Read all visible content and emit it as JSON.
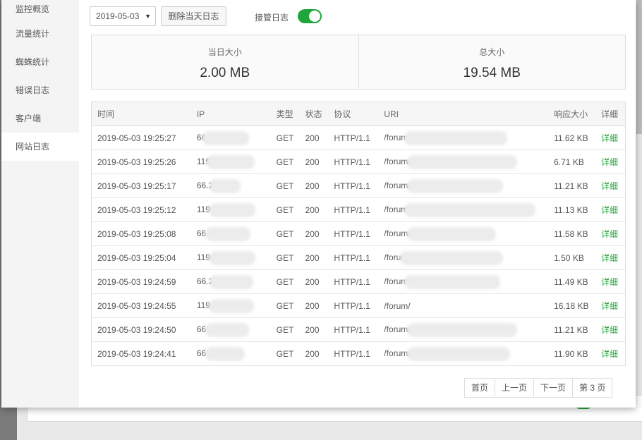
{
  "sidebar": {
    "items": [
      {
        "label": "监控概览"
      },
      {
        "label": "流量统计"
      },
      {
        "label": "蜘蛛统计"
      },
      {
        "label": "错误日志"
      },
      {
        "label": "客户端"
      },
      {
        "label": "网站日志"
      }
    ],
    "active_index": 5
  },
  "toolbar": {
    "date_value": "2019-05-03",
    "clear_label": "删除当天日志",
    "takeover_label": "接管日志",
    "takeover_on": true
  },
  "stats": {
    "day_label": "当日大小",
    "day_value": "2.00 MB",
    "total_label": "总大小",
    "total_value": "19.54 MB"
  },
  "table": {
    "headers": [
      "时间",
      "IP",
      "类型",
      "状态",
      "协议",
      "URI",
      "响应大小",
      "详细"
    ],
    "rows": [
      {
        "time": "2019-05-03 19:25:27",
        "ip": "66",
        "type": "GET",
        "status": "200",
        "proto": "HTTP/1.1",
        "uri": "/forum",
        "size": "11.62 KB",
        "detail": "详细"
      },
      {
        "time": "2019-05-03 19:25:26",
        "ip": "119",
        "type": "GET",
        "status": "200",
        "proto": "HTTP/1.1",
        "uri": "/forum/",
        "size": "6.71 KB",
        "detail": "详细"
      },
      {
        "time": "2019-05-03 19:25:17",
        "ip": "66.2",
        "type": "GET",
        "status": "200",
        "proto": "HTTP/1.1",
        "uri": "/forum/",
        "size": "11.21 KB",
        "detail": "详细"
      },
      {
        "time": "2019-05-03 19:25:12",
        "ip": "119.",
        "type": "GET",
        "status": "200",
        "proto": "HTTP/1.1",
        "uri": "/forum",
        "size": "11.13 KB",
        "detail": "详细"
      },
      {
        "time": "2019-05-03 19:25:08",
        "ip": "66.",
        "type": "GET",
        "status": "200",
        "proto": "HTTP/1.1",
        "uri": "/forum/",
        "size": "11.58 KB",
        "detail": "详细"
      },
      {
        "time": "2019-05-03 19:25:04",
        "ip": "119.",
        "type": "GET",
        "status": "200",
        "proto": "HTTP/1.1",
        "uri": "/forur",
        "size": "1.50 KB",
        "detail": "详细"
      },
      {
        "time": "2019-05-03 19:24:59",
        "ip": "66.2",
        "type": "GET",
        "status": "200",
        "proto": "HTTP/1.1",
        "uri": "/forum",
        "size": "11.49 KB",
        "detail": "详细"
      },
      {
        "time": "2019-05-03 19:24:55",
        "ip": "119.",
        "type": "GET",
        "status": "200",
        "proto": "HTTP/1.1",
        "uri": "/forum/",
        "size": "16.18 KB",
        "detail": "详细"
      },
      {
        "time": "2019-05-03 19:24:50",
        "ip": "66.",
        "type": "GET",
        "status": "200",
        "proto": "HTTP/1.1",
        "uri": "/forum/",
        "size": "11.21 KB",
        "detail": "详细"
      },
      {
        "time": "2019-05-03 19:24:41",
        "ip": "66.",
        "type": "GET",
        "status": "200",
        "proto": "HTTP/1.1",
        "uri": "/forum/",
        "size": "11.90 KB",
        "detail": "详细"
      }
    ]
  },
  "pager": {
    "first": "首页",
    "prev": "上一页",
    "next": "下一页",
    "current": "第 3 页"
  },
  "colors": {
    "accent": "#20a53a"
  }
}
